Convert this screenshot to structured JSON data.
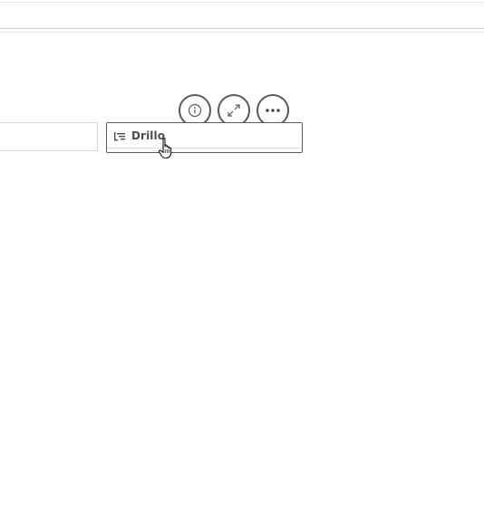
{
  "filter_panes": {
    "drill": {
      "label": "Drillo",
      "icon": "drill-down-icon"
    }
  },
  "actions": [
    {
      "name": "info",
      "icon": "info-icon"
    },
    {
      "name": "expand",
      "icon": "expand-icon"
    },
    {
      "name": "more",
      "icon": "more-icon"
    }
  ],
  "cursor": {
    "type": "pointer-hand"
  },
  "colors": {
    "border": "#595959",
    "text": "#4b4b4b",
    "background": "#ffffff"
  }
}
